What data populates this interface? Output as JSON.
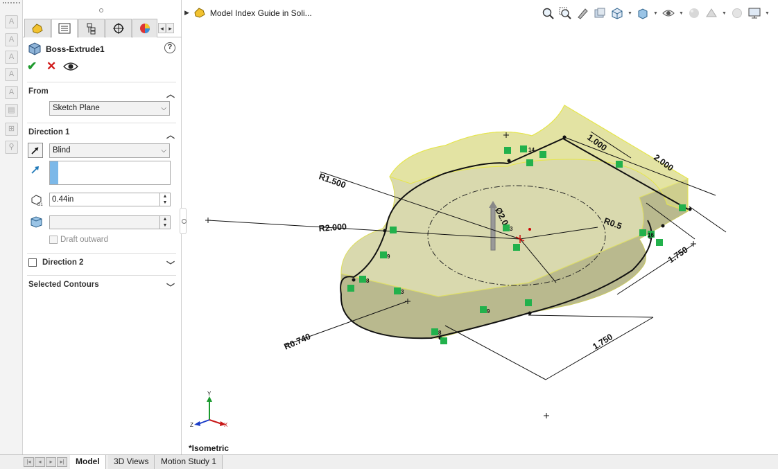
{
  "breadcrumb": {
    "title": "Model Index Guide in Soli..."
  },
  "feature": {
    "name": "Boss-Extrude1"
  },
  "from": {
    "header": "From",
    "value": "Sketch Plane"
  },
  "direction1": {
    "header": "Direction 1",
    "end_condition": "Blind",
    "depth": "0.44in",
    "draft_label": "Draft outward"
  },
  "direction2": {
    "header": "Direction 2"
  },
  "selected_contours": {
    "header": "Selected Contours"
  },
  "graphics": {
    "view_name": "*Isometric",
    "dims": {
      "r1500": "R1.500",
      "r2000": "R2.000",
      "r0740": "R0.740",
      "r05": "R0.5",
      "d1000": "1.000",
      "d2000": "2.000",
      "d1750a": "1.750",
      "d1750b": "1.750",
      "dia": "Ø2.0"
    },
    "relations": [
      "14",
      "9",
      "8",
      "3",
      "9",
      "8",
      "3",
      "16"
    ],
    "triad": {
      "x": "X",
      "y": "Y",
      "z": "Z"
    }
  },
  "bottom_tabs": [
    "Model",
    "3D Views",
    "Motion Study 1"
  ],
  "colors": {
    "part_face": "#d9d9ae",
    "part_side": "#b9b98e",
    "relation_green": "#22b14c",
    "preview": "#f5f590"
  }
}
